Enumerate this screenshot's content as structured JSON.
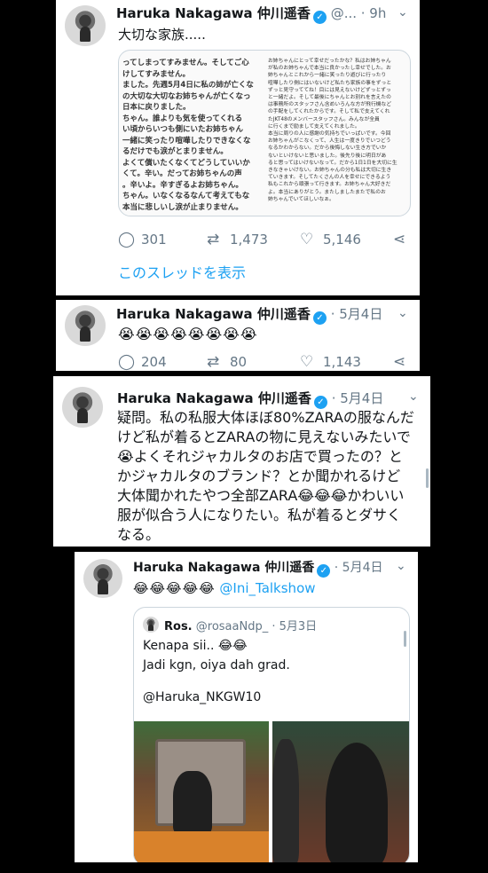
{
  "tweet1": {
    "name": "Haruka Nakagawa 仲川遥香",
    "meta": "@... · 9h",
    "text": "大切な家族.....",
    "embed_left": [
      "ってしまってすみません。そしてご心",
      "けしてすみません。",
      "ました。先週5月4日に私の姉が亡くな",
      "の大切な大切なお姉ちゃんが亡くなっ",
      "日本に戻りました。",
      "ちゃん。誰よりも気を使ってくれる",
      "い頃からいつも側にいたお姉ちゃん",
      "一緒に笑ったり喧嘩したりできなくな",
      "るだけでも涙がとまりません。",
      "よくて償いたくなくてどうしていいか",
      "くて。辛い。だってお姉ちゃんの声",
      "。辛いよ。辛すぎるよお姉ちゃん。",
      "ちゃん。いなくなるなんて考えてもな",
      "本当に悲しいし涙が止まりません。"
    ],
    "embed_right": [
      "お姉ちゃんにとって幸せだったかな？私はお姉ちゃん",
      "が私のお姉ちゃんで本当に良かったし幸せでした。お",
      "姉ちゃんとこれから一緒に笑ったり遊びに行ったり",
      "喧嘩したり側にはいないけど私たち家族の事をずっと",
      "ずっと見守っててね！目には見えないけどずっとずっ",
      "と一緒だよ。そして最後にちゃんとお別れを言えたの",
      "は事務所のスタッフさん含めいろんな方が飛行機など",
      "の手配をしてくれたからです。そして私で支えてくれ",
      "たJKT48のメンバースタッフさん。みんなが全員",
      "に行くまで励まして支えてくれました。",
      "",
      "本当に周りの人に感謝の気持ちでいっぱいです。今回",
      "お姉ちゃんがこなくって、人生は一度きりでいつどう",
      "なるかわからない。だから後悔しない生き方でいか",
      "ないといけないと思いました。後先り後に明日があ",
      "ると思ってはいけないなって。だから1日1日を大切に生",
      "きなきゃいけない。お姉ちゃんの分も私は大切に生き",
      "ていきます。そしてたくさんの人を幸せにできるよう",
      "私もこれから頑張って行きます。お姉ちゃん大好きだ",
      "よ。本当にありがとう。またしましたまたで私のお",
      "姉ちゃんでいてほしいなぁ。"
    ],
    "replies": "301",
    "retweets": "1,473",
    "likes": "5,146",
    "thread_link": "このスレッドを表示"
  },
  "tweet2": {
    "name": "Haruka Nakagawa 仲川遥香",
    "meta": "· 5月4日",
    "text": "😭😭😭😭😭😭😭😭",
    "replies": "204",
    "retweets": "80",
    "likes": "1,143"
  },
  "tweet3": {
    "name": "Haruka Nakagawa 仲川遥香",
    "meta": "· 5月4日",
    "line1": "疑問。私の私服大体ほぼ80%ZARAの服なんだ",
    "line2": "けど私が着るとZARAの物に見えないみたいで",
    "line3": "😭よくそれジャカルタのお店で買ったの？と",
    "line4": "かジャカルタのブランド？とか聞かれるけど",
    "line5": "大体聞かれたやつ全部ZARA😂😂😂かわいい",
    "line6": "服が似合う人になりたい。私が着るとダサく",
    "line7": "なる。"
  },
  "tweet4": {
    "name": "Haruka Nakagawa 仲川遥香",
    "meta": "· 5月4日",
    "emojis": "😂😂😂😂😂",
    "mention": "@Ini_Talkshow",
    "quote": {
      "name": "Ros.",
      "meta": "@rosaaNdp_ · 5月3日",
      "line1": "Kenapa sii.. 😂😂",
      "line2": "Jadi kgn, oiya dah grad.",
      "line3": "@Haruka_NKGW10"
    }
  },
  "colors": {
    "accent": "#1da1f2",
    "muted": "#657786"
  }
}
